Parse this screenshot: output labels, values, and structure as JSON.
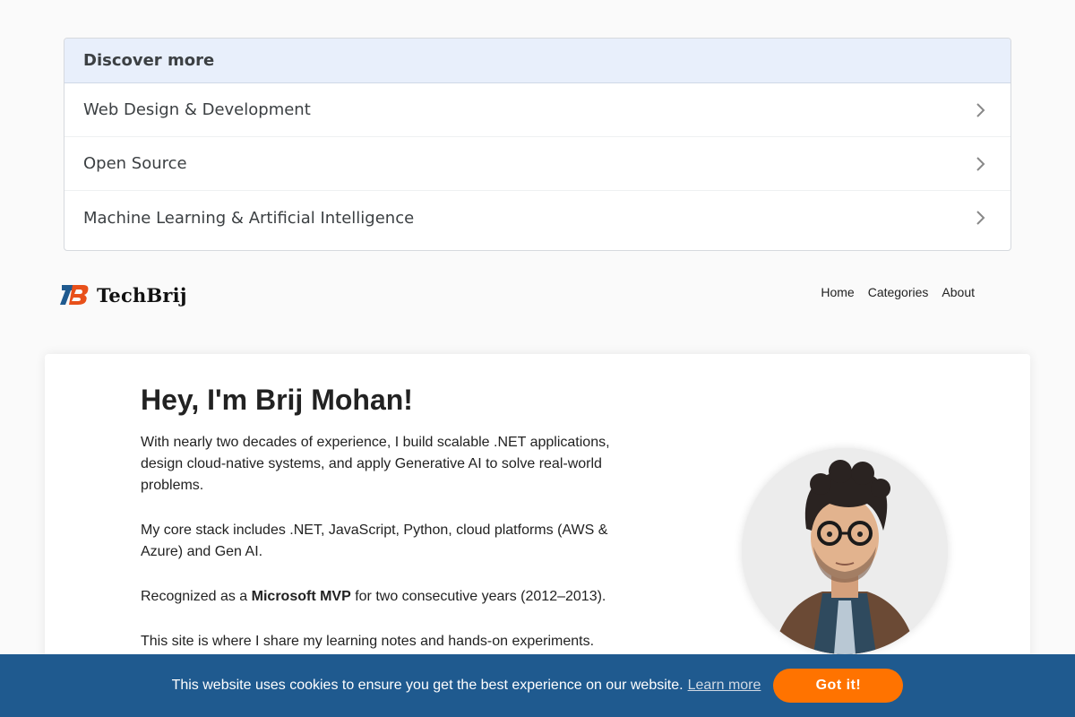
{
  "discover": {
    "title": "Discover more",
    "items": [
      {
        "label": "Web Design & Development"
      },
      {
        "label": "Open Source"
      },
      {
        "label": "Machine Learning & Artificial Intelligence"
      }
    ]
  },
  "header": {
    "logo_text": "TechBrij",
    "nav": [
      "Home",
      "Categories",
      "About"
    ]
  },
  "hero": {
    "title": "Hey, I'm Brij Mohan!",
    "p1": "With nearly two decades of experience, I build scalable .NET applications, design cloud-native systems, and apply Generative AI to solve real-world problems.",
    "p2": "My core stack includes .NET, JavaScript, Python, cloud platforms (AWS & Azure) and Gen AI.",
    "p3_before": "Recognized as a ",
    "p3_bold": "Microsoft MVP",
    "p3_after": " for two consecutive years (2012–2013).",
    "p4": "This site is where I share my learning notes and hands-on experiments."
  },
  "cookie": {
    "message": "This website uses cookies to ensure you get the best experience on our website.",
    "link": "Learn more",
    "button": "Got it!"
  },
  "colors": {
    "cookie_bg": "#1f5a8f",
    "cookie_button": "#ff7300",
    "discover_header_bg": "#e8effb"
  }
}
